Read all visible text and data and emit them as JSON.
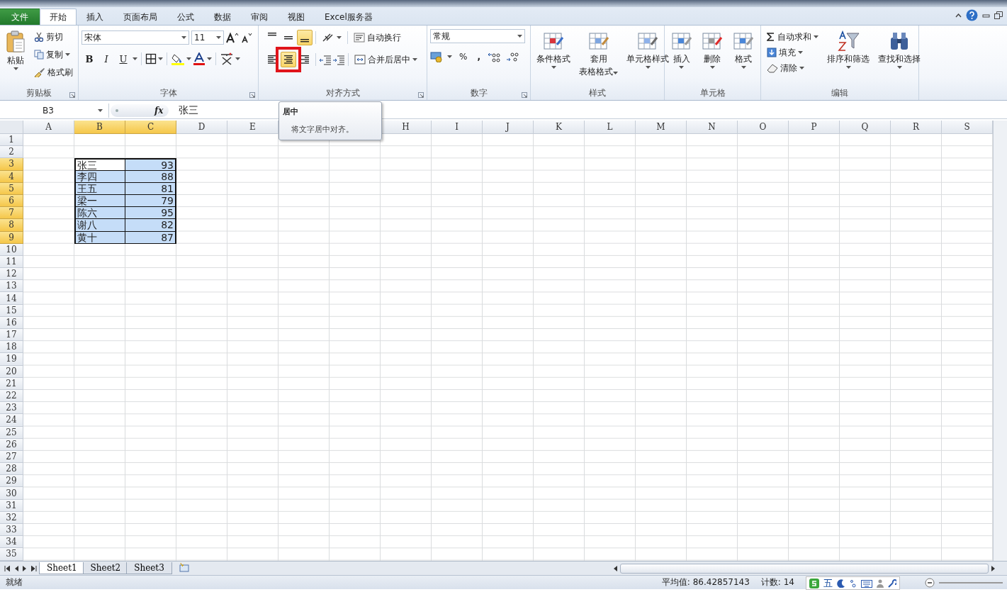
{
  "tabs": [
    {
      "label": "文件",
      "kind": "file",
      "selected": false
    },
    {
      "label": "开始",
      "kind": "tab",
      "selected": true
    },
    {
      "label": "插入",
      "kind": "tab",
      "selected": false
    },
    {
      "label": "页面布局",
      "kind": "tab",
      "selected": false
    },
    {
      "label": "公式",
      "kind": "tab",
      "selected": false
    },
    {
      "label": "数据",
      "kind": "tab",
      "selected": false
    },
    {
      "label": "审阅",
      "kind": "tab",
      "selected": false
    },
    {
      "label": "视图",
      "kind": "tab",
      "selected": false
    },
    {
      "label": "Excel服务器",
      "kind": "tab",
      "selected": false
    }
  ],
  "clipboard": {
    "title": "剪贴板",
    "paste": "粘贴",
    "cut": "剪切",
    "copy": "复制",
    "painter": "格式刷"
  },
  "font": {
    "title": "字体",
    "font_name": "宋体",
    "font_size": "11",
    "style_buttons": [
      {
        "label": "B",
        "kind": "bold"
      },
      {
        "label": "I",
        "kind": "italic"
      },
      {
        "label": "U",
        "kind": "underline"
      }
    ]
  },
  "alignment": {
    "title": "对齐方式",
    "wrap": "自动换行",
    "merge": "合并后居中",
    "vertical_buttons": [
      {
        "kind": "top",
        "pressed": false
      },
      {
        "kind": "middle",
        "pressed": false
      },
      {
        "kind": "bottom",
        "pressed": true
      }
    ],
    "horizontal_buttons": [
      {
        "kind": "left",
        "pressed": false
      },
      {
        "kind": "center",
        "pressed": true,
        "highlighted": true
      },
      {
        "kind": "right",
        "pressed": false
      }
    ]
  },
  "number": {
    "title": "数字",
    "format": "常规",
    "percent": "%",
    "comma": ","
  },
  "styles": {
    "title": "样式",
    "buttons": [
      {
        "label": "条件格式"
      },
      {
        "label": "套用",
        "label_2": "表格格式"
      },
      {
        "label": "单元格样式"
      }
    ]
  },
  "cells": {
    "title": "单元格",
    "buttons": [
      "插入",
      "删除",
      "格式"
    ]
  },
  "editing": {
    "title": "编辑",
    "autosum": "自动求和",
    "fill": "填充",
    "clear": "清除",
    "sort": "排序和筛选",
    "find": "查找和选择"
  },
  "formula_bar": {
    "name_box": "B3",
    "function_label": "fx",
    "formula": "张三"
  },
  "tooltip": {
    "title": "居中",
    "text": "将文字居中对齐。"
  },
  "sheet": {
    "columns": [
      {
        "label": "A",
        "selected": false
      },
      {
        "label": "B",
        "selected": true
      },
      {
        "label": "C",
        "selected": true
      },
      {
        "label": "D",
        "selected": false
      },
      {
        "label": "E",
        "selected": false
      },
      {
        "label": "H",
        "selected": false
      },
      {
        "label": "I",
        "selected": false
      },
      {
        "label": "J",
        "selected": false
      },
      {
        "label": "K",
        "selected": false
      },
      {
        "label": "L",
        "selected": false
      },
      {
        "label": "M",
        "selected": false
      },
      {
        "label": "N",
        "selected": false
      },
      {
        "label": "O",
        "selected": false
      },
      {
        "label": "P",
        "selected": false
      },
      {
        "label": "Q",
        "selected": false
      },
      {
        "label": "R",
        "selected": false
      },
      {
        "label": "S",
        "selected": false
      }
    ],
    "rows": [
      {
        "label": "1",
        "selected": false
      },
      {
        "label": "2",
        "selected": false
      },
      {
        "label": "3",
        "selected": true
      },
      {
        "label": "4",
        "selected": true
      },
      {
        "label": "5",
        "selected": true
      },
      {
        "label": "6",
        "selected": true
      },
      {
        "label": "7",
        "selected": true
      },
      {
        "label": "8",
        "selected": true
      },
      {
        "label": "9",
        "selected": true
      },
      {
        "label": "10",
        "selected": false
      },
      {
        "label": "11",
        "selected": false
      },
      {
        "label": "12",
        "selected": false
      },
      {
        "label": "13",
        "selected": false
      },
      {
        "label": "14",
        "selected": false
      },
      {
        "label": "15",
        "selected": false
      },
      {
        "label": "16",
        "selected": false
      },
      {
        "label": "17",
        "selected": false
      },
      {
        "label": "18",
        "selected": false
      },
      {
        "label": "19",
        "selected": false
      },
      {
        "label": "20",
        "selected": false
      },
      {
        "label": "21",
        "selected": false
      },
      {
        "label": "22",
        "selected": false
      },
      {
        "label": "23",
        "selected": false
      },
      {
        "label": "24",
        "selected": false
      },
      {
        "label": "25",
        "selected": false
      },
      {
        "label": "26",
        "selected": false
      },
      {
        "label": "27",
        "selected": false
      },
      {
        "label": "28",
        "selected": false
      },
      {
        "label": "29",
        "selected": false
      },
      {
        "label": "30",
        "selected": false
      },
      {
        "label": "31",
        "selected": false
      },
      {
        "label": "32",
        "selected": false
      },
      {
        "label": "33",
        "selected": false
      },
      {
        "label": "34",
        "selected": false
      },
      {
        "label": "35",
        "selected": false
      }
    ],
    "data": [
      {
        "name": "张三",
        "score": "93",
        "active": true
      },
      {
        "name": "李四",
        "score": "88",
        "active": false
      },
      {
        "name": "王五",
        "score": "81",
        "active": false
      },
      {
        "name": "梁一",
        "score": "79",
        "active": false
      },
      {
        "name": "陈六",
        "score": "95",
        "active": false
      },
      {
        "name": "谢八",
        "score": "82",
        "active": false
      },
      {
        "name": "黄十",
        "score": "87",
        "active": false
      }
    ]
  },
  "sheet_tabs": [
    {
      "label": "Sheet1",
      "selected": true
    },
    {
      "label": "Sheet2",
      "selected": false
    },
    {
      "label": "Sheet3",
      "selected": false
    }
  ],
  "status_bar": {
    "state": "就绪",
    "average": "平均值: 86.42857143",
    "count": "计数: 14"
  },
  "ime_bar": {
    "mode": "五"
  }
}
